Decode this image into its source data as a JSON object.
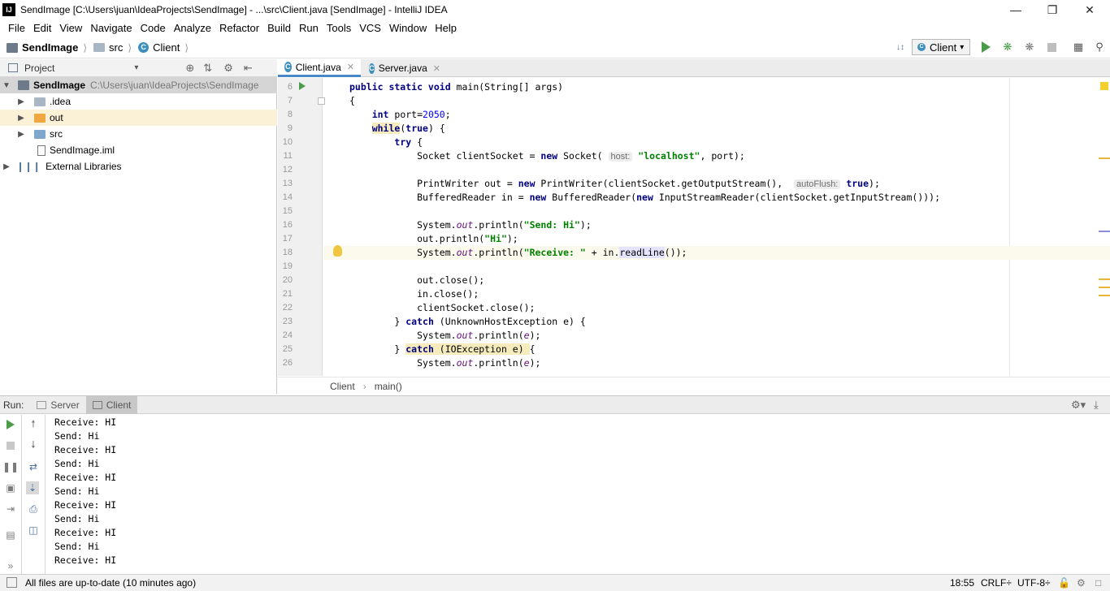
{
  "window": {
    "logo": "IJ",
    "title": "SendImage [C:\\Users\\juan\\IdeaProjects\\SendImage] - ...\\src\\Client.java [SendImage] - IntelliJ IDEA",
    "minimize_icon": "minimize-icon",
    "maximize_icon": "maximize-icon",
    "close_icon": "close-icon"
  },
  "menu": [
    "File",
    "Edit",
    "View",
    "Navigate",
    "Code",
    "Analyze",
    "Refactor",
    "Build",
    "Run",
    "Tools",
    "VCS",
    "Window",
    "Help"
  ],
  "navbar": {
    "project": "SendImage",
    "folder": "src",
    "file": "Client"
  },
  "toolbar": {
    "run_config": "Client"
  },
  "project_panel": {
    "title": "Project",
    "tree": [
      {
        "label": "SendImage",
        "path": "C:\\Users\\juan\\IdeaProjects\\SendImage"
      },
      {
        "label": ".idea"
      },
      {
        "label": "out"
      },
      {
        "label": "src"
      },
      {
        "label": "SendImage.iml"
      },
      {
        "label": "External Libraries"
      }
    ]
  },
  "editor": {
    "tabs": [
      {
        "label": "Client.java",
        "active": true
      },
      {
        "label": "Server.java",
        "active": false
      }
    ],
    "line_numbers": [
      "6",
      "7",
      "8",
      "9",
      "10",
      "11",
      "12",
      "13",
      "14",
      "15",
      "16",
      "17",
      "18",
      "19",
      "20",
      "21",
      "22",
      "23",
      "24",
      "25",
      "26"
    ],
    "hints": {
      "host": "host:",
      "autoflush": "autoFlush:"
    },
    "breadcrumb": [
      "Client",
      "main()"
    ]
  },
  "run_panel": {
    "label": "Run:",
    "tabs": [
      "Server",
      "Client"
    ],
    "output": [
      "Receive: HI",
      "Send: Hi",
      "Receive: HI",
      "Send: Hi",
      "Receive: HI",
      "Send: Hi",
      "Receive: HI",
      "Send: Hi",
      "Receive: HI",
      "Send: Hi",
      "Receive: HI"
    ]
  },
  "statusbar": {
    "message": "All files are up-to-date (10 minutes ago)",
    "position": "18:55",
    "line_separator": "CRLF÷",
    "encoding": "UTF-8÷"
  },
  "colors": {
    "keyword": "#000080",
    "number": "#0000ff",
    "string": "#008000",
    "field": "#660e7a",
    "tab_accent": "#4a88c7",
    "run_green": "#4a9c4a"
  }
}
